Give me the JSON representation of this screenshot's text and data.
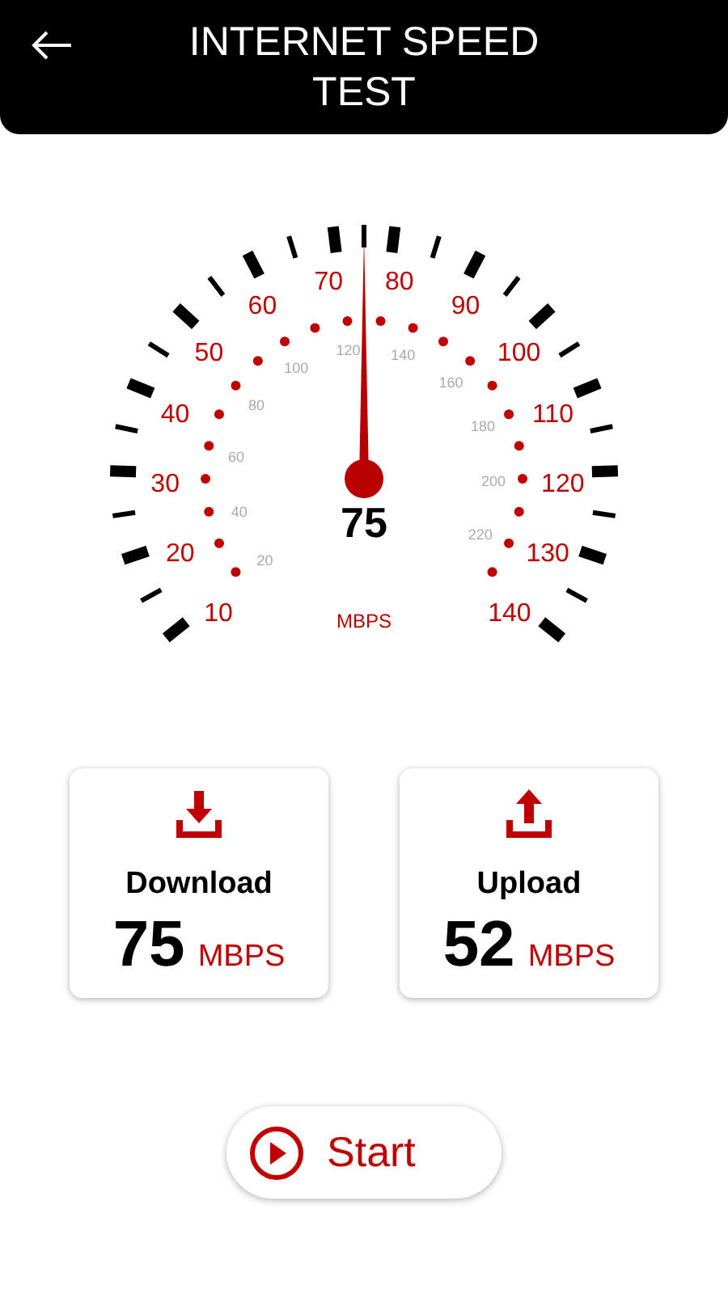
{
  "header": {
    "title": "INTERNET SPEED TEST"
  },
  "gauge": {
    "scale_labels": [
      "10",
      "20",
      "30",
      "40",
      "50",
      "60",
      "70",
      "80",
      "90",
      "100",
      "110",
      "120",
      "130",
      "140"
    ],
    "inner_labels": [
      "20",
      "40",
      "60",
      "80",
      "100",
      "120",
      "140",
      "160",
      "180",
      "200",
      "220"
    ],
    "level": 0.5,
    "reading": "75",
    "unit": "MBPS"
  },
  "cards": [
    {
      "kind": "download",
      "label": "Download",
      "value": "75",
      "unit": "MBPS"
    },
    {
      "kind": "upload",
      "label": "Upload",
      "value": "52",
      "unit": "MBPS"
    }
  ],
  "start_button": {
    "label": "Start"
  }
}
